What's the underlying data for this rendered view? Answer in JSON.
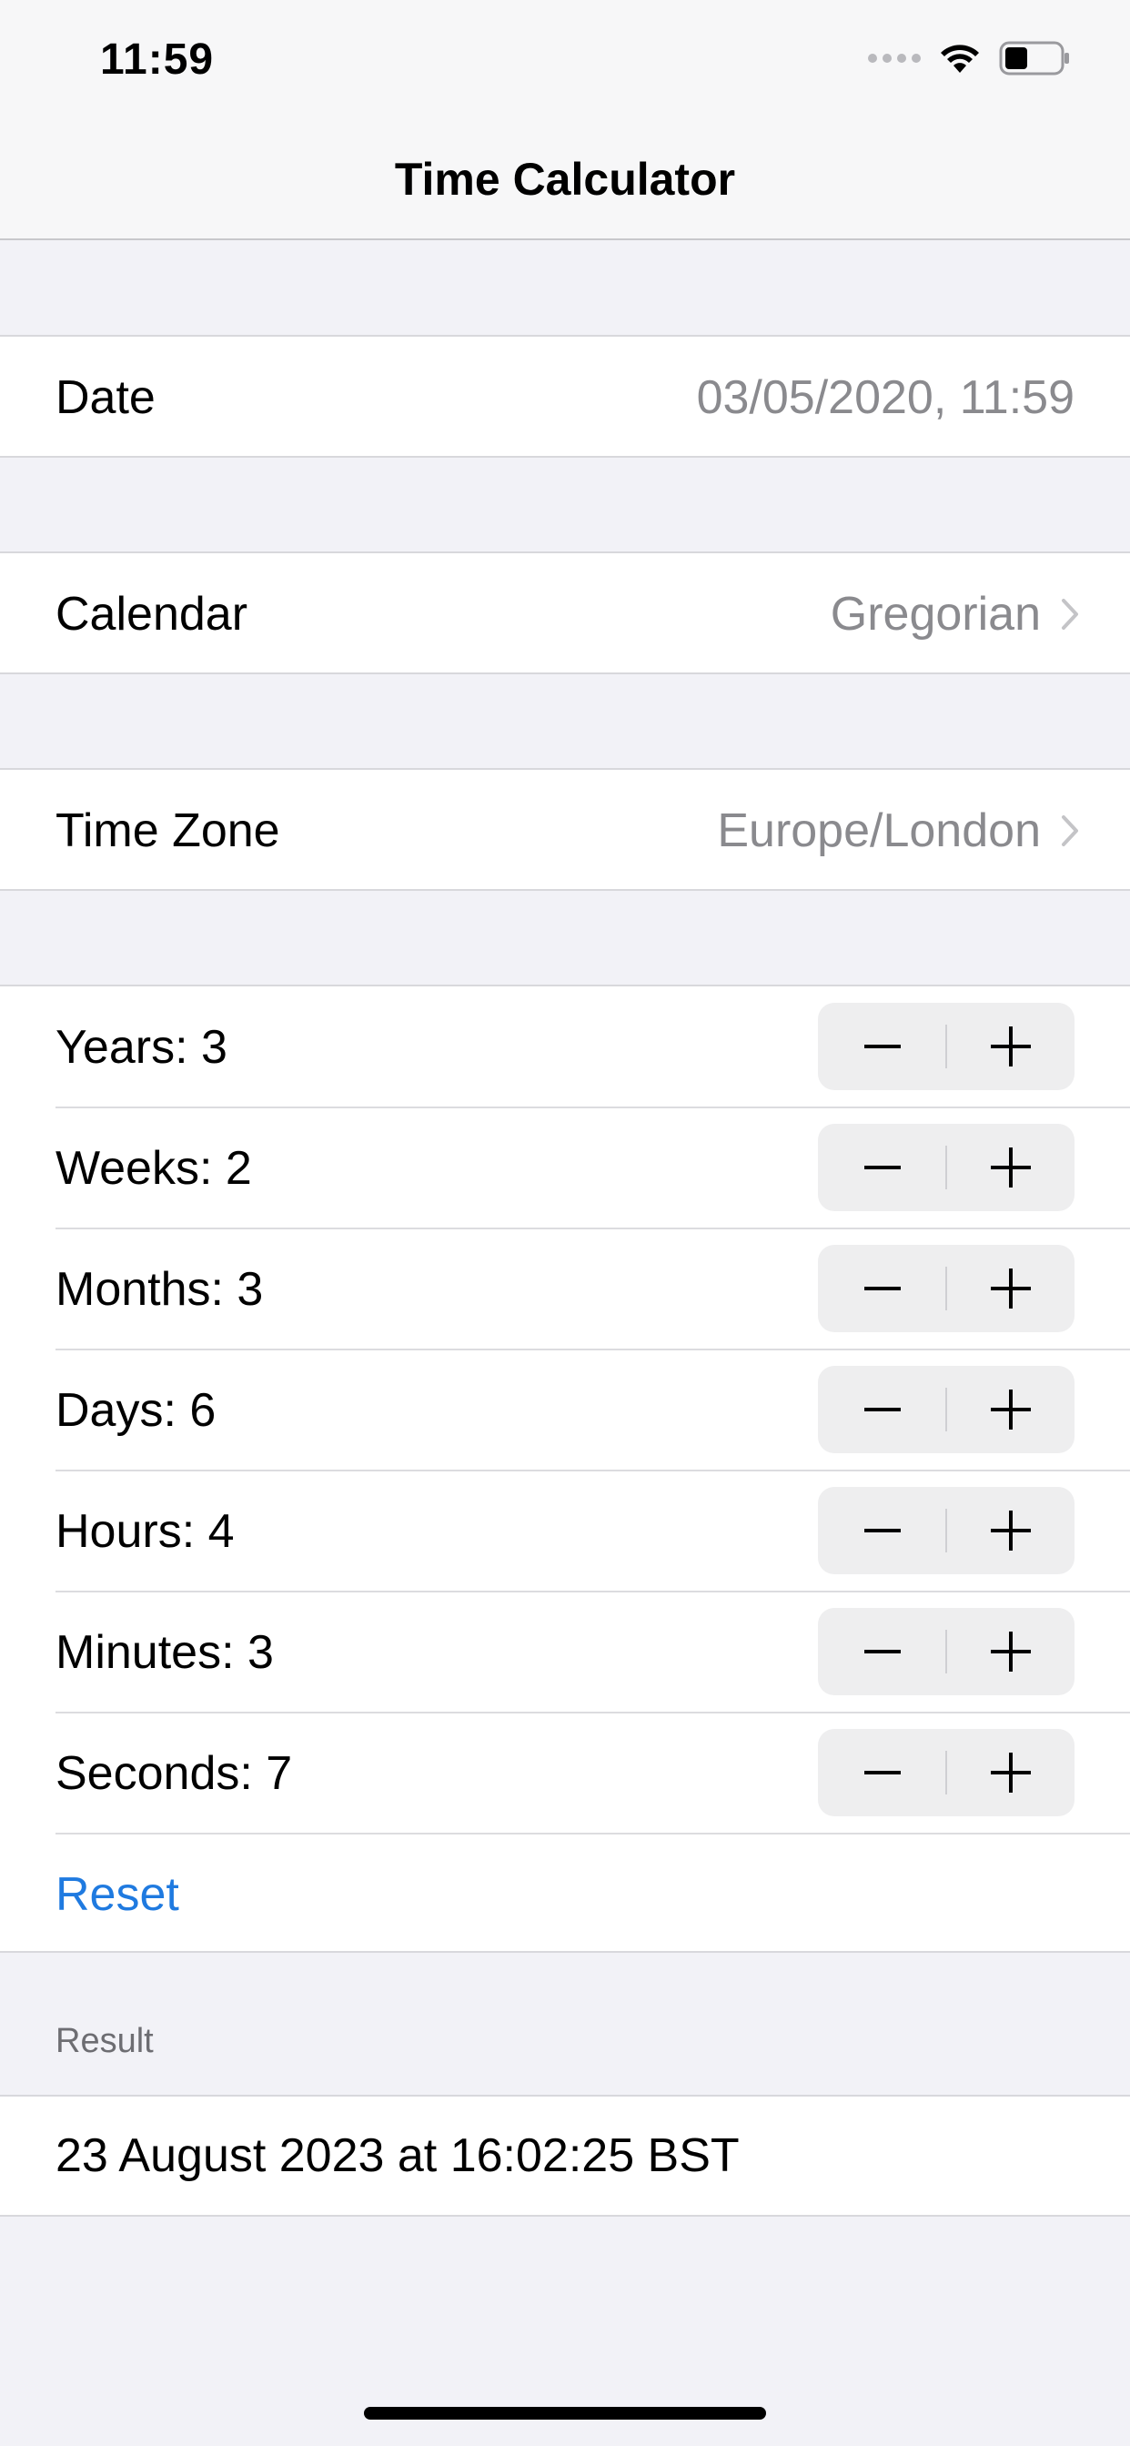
{
  "status_bar": {
    "time": "11:59"
  },
  "nav": {
    "title": "Time Calculator"
  },
  "date": {
    "label": "Date",
    "value": "03/05/2020, 11:59"
  },
  "calendar": {
    "label": "Calendar",
    "value": "Gregorian"
  },
  "time_zone": {
    "label": "Time Zone",
    "value": "Europe/London"
  },
  "steppers": [
    {
      "label": "Years: 3"
    },
    {
      "label": "Weeks: 2"
    },
    {
      "label": "Months: 3"
    },
    {
      "label": "Days: 6"
    },
    {
      "label": "Hours: 4"
    },
    {
      "label": "Minutes: 3"
    },
    {
      "label": "Seconds: 7"
    }
  ],
  "reset_label": "Reset",
  "result": {
    "header": "Result",
    "value": "23 August 2023 at 16:02:25 BST"
  },
  "colors": {
    "accent": "#1f7ae0",
    "background": "#f2f2f7",
    "secondary_text": "#8a8a8e"
  }
}
